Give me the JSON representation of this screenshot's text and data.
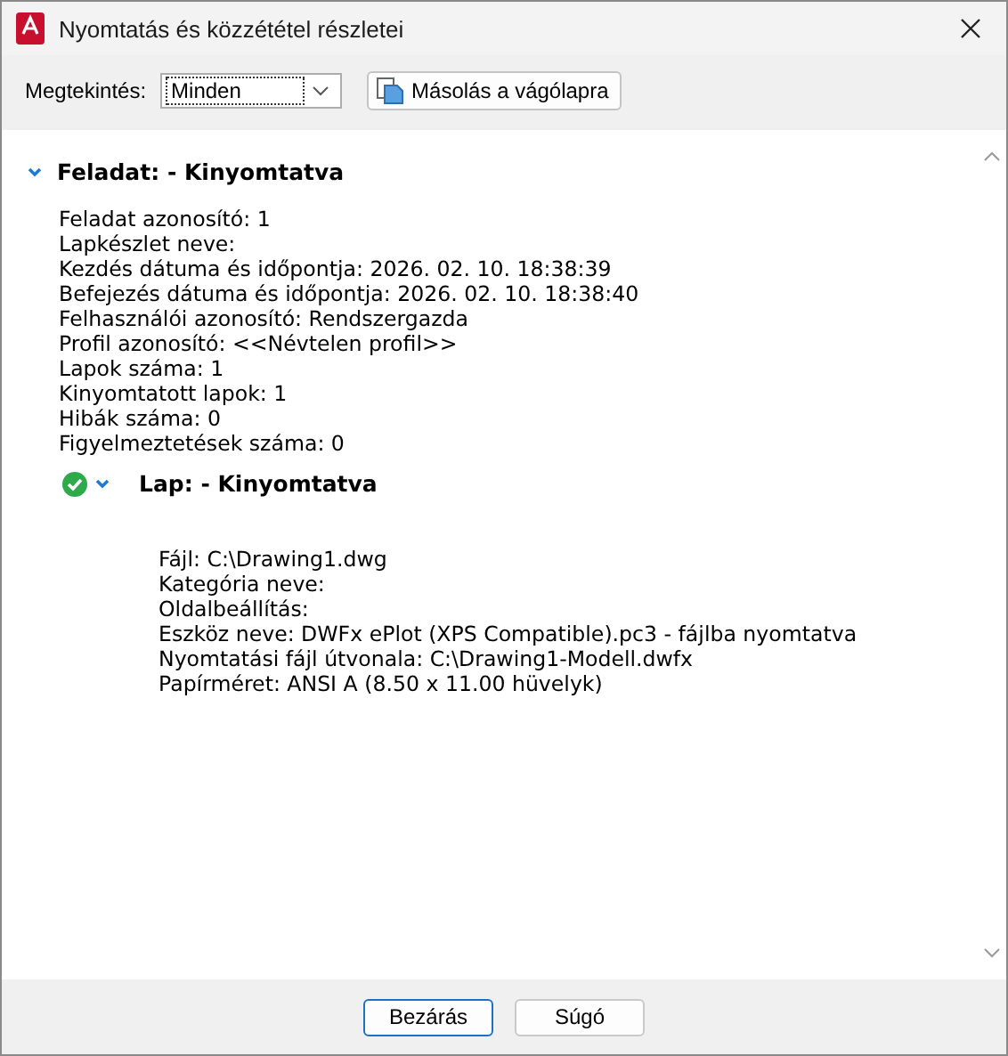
{
  "window": {
    "title": "Nyomtatás és közzététel részletei"
  },
  "toolbar": {
    "view_label": "Megtekintés:",
    "view_value": "Minden",
    "copy_button": "Másolás a vágólapra"
  },
  "job": {
    "title": "Feladat: - Kinyomtatva",
    "expanded": true,
    "lines": [
      "Feladat azonosító: 1",
      "Lapkészlet neve:",
      "Kezdés dátuma és időpontja: 2026. 02. 10. 18:38:39",
      "Befejezés dátuma és időpontja: 2026. 02. 10. 18:38:40",
      "Felhasználói azonosító: Rendszergazda",
      "Profil azonosító: <<Névtelen profil>>",
      "Lapok száma: 1",
      "Kinyomtatott lapok: 1",
      "Hibák száma: 0",
      "Figyelmeztetések száma: 0"
    ],
    "sheets": [
      {
        "title": "Lap: - Kinyomtatva",
        "expanded": true,
        "lines": [
          "Fájl: C:\\Drawing1.dwg",
          "Kategória neve:",
          "Oldalbeállítás:",
          "Eszköz neve: DWFx ePlot (XPS Compatible).pc3 - fájlba nyomtatva",
          "Nyomtatási fájl útvonala: C:\\Drawing1-Modell.dwfx",
          "Papírméret: ANSI A (8.50 x 11.00 hüvelyk)"
        ]
      }
    ]
  },
  "buttons": [
    "Bezárás",
    "Súgó"
  ]
}
